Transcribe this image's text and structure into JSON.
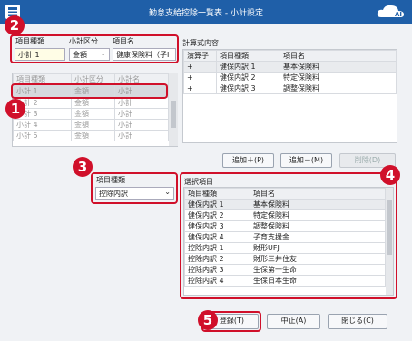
{
  "window": {
    "title": "勤怠支給控除一覧表 - 小計設定"
  },
  "top_fields": {
    "item_type_label": "項目種類",
    "subtotal_type_label": "小計区分",
    "item_name_label": "項目名",
    "item_type_value": "小計 1",
    "subtotal_type_value": "金額",
    "item_name_value": "健康保険料（子I"
  },
  "subtotal_table": {
    "headers": [
      "項目種類",
      "小計区分",
      "小計名"
    ],
    "rows": [
      [
        "小計 1",
        "金額",
        "小計"
      ],
      [
        "小計 2",
        "金額",
        "小計"
      ],
      [
        "小計 3",
        "金額",
        "小計"
      ],
      [
        "小計 4",
        "金額",
        "小計"
      ],
      [
        "小計 5",
        "金額",
        "小計"
      ]
    ]
  },
  "formula": {
    "label": "計算式内容",
    "headers": [
      "演算子",
      "項目種類",
      "項目名"
    ],
    "rows": [
      [
        "+",
        "健保内訳 1",
        "基本保険料"
      ],
      [
        "+",
        "健保内訳 2",
        "特定保険料"
      ],
      [
        "+",
        "健保内訳 3",
        "調整保険料"
      ]
    ]
  },
  "buttons": {
    "add_plus": "追加＋(P)",
    "add_minus": "追加－(M)",
    "delete": "削除(D)",
    "register": "登録(T)",
    "cancel": "中止(A)",
    "close": "閉じる(C)"
  },
  "item_type_select": {
    "label": "項目種類",
    "value": "控除内訳"
  },
  "selection": {
    "label": "選択項目",
    "headers": [
      "項目種類",
      "項目名"
    ],
    "rows": [
      [
        "健保内訳 1",
        "基本保険料"
      ],
      [
        "健保内訳 2",
        "特定保険料"
      ],
      [
        "健保内訳 3",
        "調整保険料"
      ],
      [
        "健保内訳 4",
        "子育支援金"
      ],
      [
        "控除内訳 1",
        "財形UFJ"
      ],
      [
        "控除内訳 2",
        "財形三井住友"
      ],
      [
        "控除内訳 3",
        "生保第一生命"
      ],
      [
        "控除内訳 4",
        "生保日本生命"
      ]
    ]
  },
  "badges": [
    "1",
    "2",
    "3",
    "4",
    "5"
  ],
  "colors": {
    "titlebar": "#1f5fa8",
    "highlight_red": "#d0102a"
  }
}
